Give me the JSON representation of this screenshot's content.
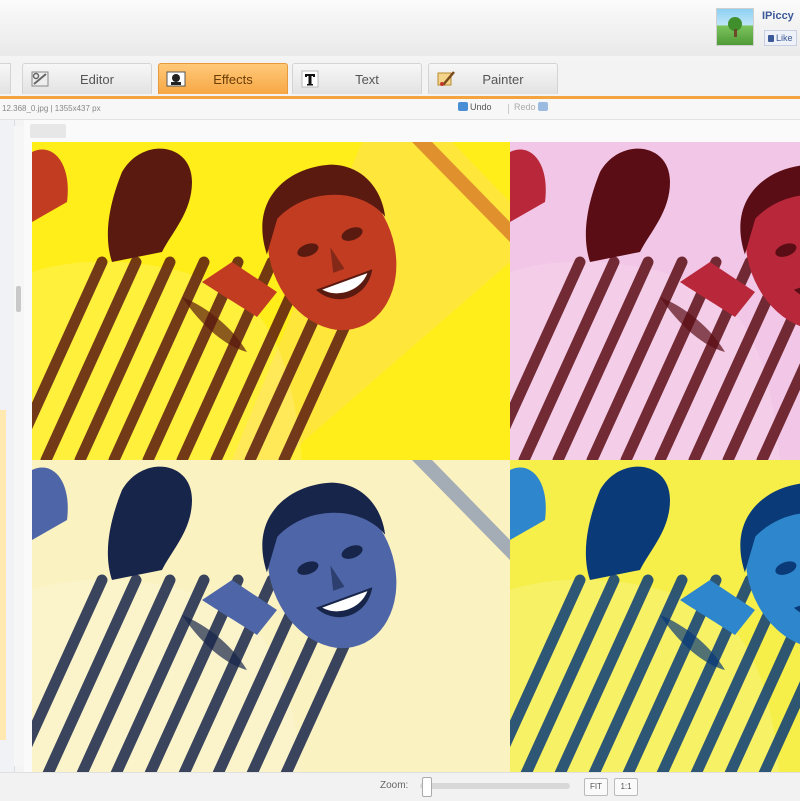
{
  "header": {
    "site_name": "IPiccy",
    "like_label": "Like"
  },
  "tabs": [
    {
      "label": "Editor",
      "icon": "tools-icon",
      "active": false
    },
    {
      "label": "Effects",
      "icon": "effects-icon",
      "active": true
    },
    {
      "label": "Text",
      "icon": "text-t-icon",
      "active": false
    },
    {
      "label": "Painter",
      "icon": "paint-brush-icon",
      "active": false
    }
  ],
  "toolbar": {
    "file_info": "12.368_0.jpg  |  1355x437 px",
    "undo_label": "Undo",
    "redo_label": "Redo"
  },
  "canvas": {
    "effect": "pop-art-4-panel",
    "panels": [
      {
        "bg": "#ffee1a",
        "ink": "#5a1a10",
        "shade": "#c23c22",
        "light": "#ffe34a"
      },
      {
        "bg": "#f2c6e6",
        "ink": "#5a0d14",
        "shade": "#b8283a",
        "light": "#f2c6e6"
      },
      {
        "bg": "#fbf2c2",
        "ink": "#18254a",
        "shade": "#4e66a8",
        "light": "#fbf2c2"
      },
      {
        "bg": "#f6ef4a",
        "ink": "#0a3b78",
        "shade": "#2e86cc",
        "light": "#f6ef4a"
      }
    ],
    "accent_color": "#f4a43e"
  },
  "zoombar": {
    "zoom_label": "Zoom:",
    "zoom_value": 0,
    "fit_label": "FIT",
    "actual_label": "1:1"
  }
}
